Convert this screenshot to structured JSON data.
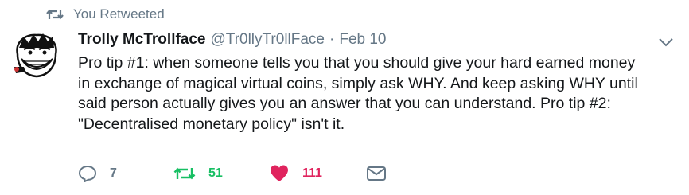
{
  "retweet_notice": {
    "text": "You Retweeted",
    "icon": "retweet-icon"
  },
  "tweet": {
    "display_name": "Trolly McTrollface",
    "handle": "@Tr0llyTr0llFace",
    "separator": "·",
    "date": "Feb 10",
    "text": "Pro tip #1: when someone tells you that you should give your hard earned money\nin exchange of magical virtual coins, simply ask WHY. And keep asking WHY until\nsaid person actually gives you an answer that you can understand. Pro tip #2:\n\"Decentralised monetary policy\" isn't it."
  },
  "actions": {
    "reply": {
      "count": "7",
      "icon": "reply-icon"
    },
    "retweet": {
      "count": "51",
      "icon": "retweet-icon",
      "active": true
    },
    "like": {
      "count": "111",
      "icon": "heart-icon",
      "active": true
    },
    "dm": {
      "icon": "envelope-icon"
    }
  },
  "colors": {
    "text_primary": "#14171a",
    "text_secondary": "#657786",
    "retweet_green": "#17bf63",
    "like_red": "#e0245e"
  }
}
